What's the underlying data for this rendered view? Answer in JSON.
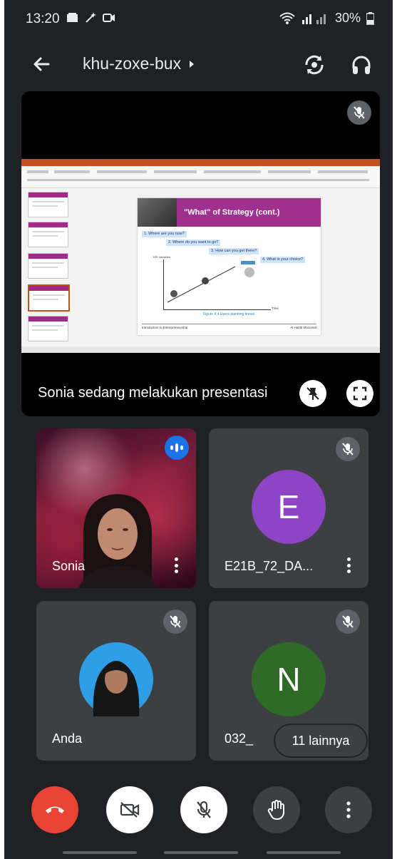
{
  "status_bar": {
    "time": "13:20",
    "battery": "30%"
  },
  "app_bar": {
    "meeting_code": "khu-zoxe-bux"
  },
  "presentation": {
    "label": "Sonia sedang melakukan presentasi",
    "slide": {
      "title": "\"What\" of Strategy (cont.)",
      "questions": [
        "1. Where are you now?",
        "2. Where do you want to go?",
        "3. How can you get there?",
        "4. What is your choice?"
      ],
      "y_axis": "KPI Variables",
      "x_axis": "Time",
      "figure_caption": "Figure 4.4 Users planning tiresei",
      "footer_left": "Introduction to Entrepreneurship",
      "footer_right": "Al Habib Mazumat"
    }
  },
  "participants": [
    {
      "name": "Sonia",
      "speaking": true
    },
    {
      "name": "E21B_72_DA...",
      "initial": "E",
      "avatar_color": "#8e44c4",
      "muted": true
    },
    {
      "name": "Anda",
      "muted": true
    },
    {
      "name": "032_",
      "initial": "N",
      "avatar_color": "#2e6b25",
      "muted": true
    }
  ],
  "more_participants": "11 lainnya",
  "colors": {
    "background": "#202124",
    "tile": "#3c4043",
    "end_call": "#ea4335",
    "speaking": "#1a73e8"
  }
}
